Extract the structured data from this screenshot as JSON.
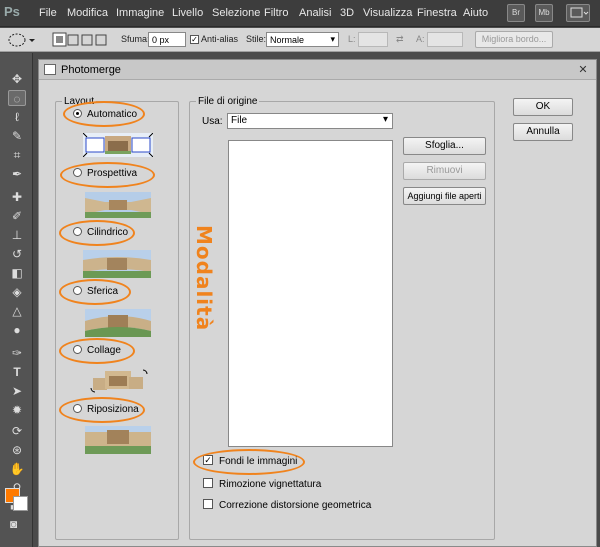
{
  "app": {
    "logo": "Ps"
  },
  "menubar": {
    "items": [
      "File",
      "Modifica",
      "Immagine",
      "Livello",
      "Selezione",
      "Filtro",
      "Analisi",
      "3D",
      "Visualizza",
      "Finestra",
      "Aiuto"
    ],
    "buttons": [
      "Br",
      "Mb"
    ]
  },
  "options": {
    "sfuma_label": "Sfuma:",
    "sfuma_value": "0 px",
    "antialias_label": "Anti-alias",
    "antialias_checked": true,
    "stile_label": "Stile:",
    "stile_value": "Normale",
    "l_label": "L:",
    "a_label": "A:",
    "refine_label": "Migliora bordo..."
  },
  "colors": {
    "accent": "#f0831d",
    "foreground": "#ff7a00",
    "background": "#ffffff"
  },
  "dialog": {
    "title": "Photomerge",
    "layout": {
      "legend": "Layout",
      "options": [
        {
          "label": "Automatico",
          "selected": true
        },
        {
          "label": "Prospettiva",
          "selected": false
        },
        {
          "label": "Cilindrico",
          "selected": false
        },
        {
          "label": "Sferica",
          "selected": false
        },
        {
          "label": "Collage",
          "selected": false
        },
        {
          "label": "Riposiziona",
          "selected": false
        }
      ],
      "annotation": "Modalità"
    },
    "source": {
      "legend": "File di origine",
      "use_label": "Usa:",
      "use_value": "File",
      "browse_label": "Sfoglia...",
      "remove_label": "Rimuovi",
      "add_open_label": "Aggiungi file aperti"
    },
    "checks": [
      {
        "label": "Fondi le immagini",
        "checked": true
      },
      {
        "label": "Rimozione vignettatura",
        "checked": false
      },
      {
        "label": "Correzione distorsione geometrica",
        "checked": false
      }
    ],
    "ok_label": "OK",
    "cancel_label": "Annulla"
  }
}
